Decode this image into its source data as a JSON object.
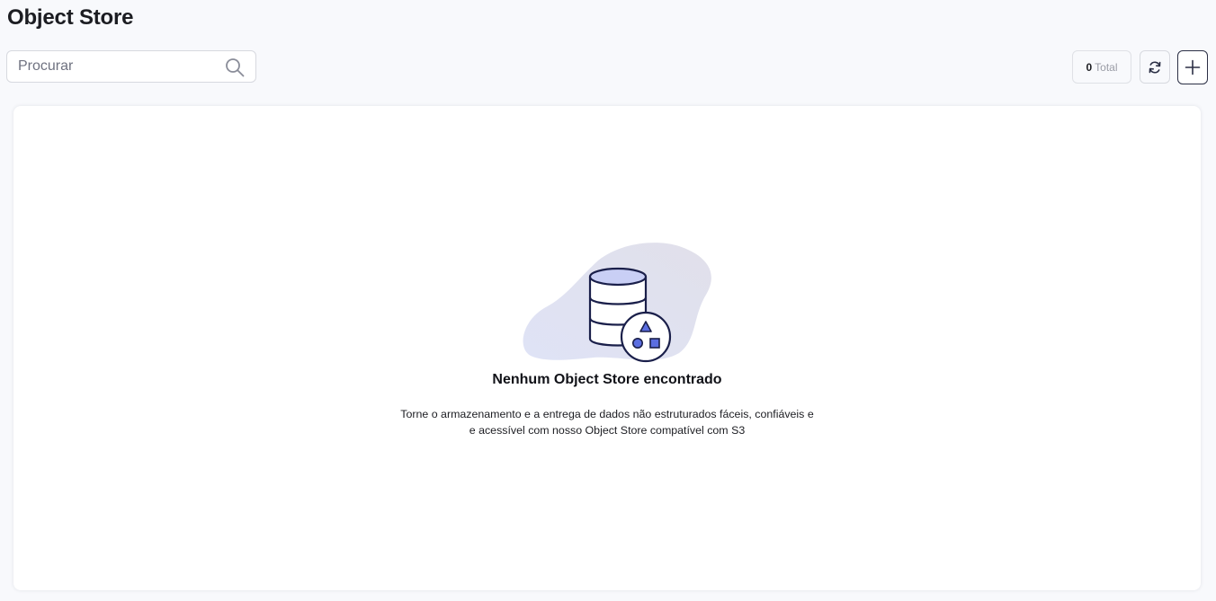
{
  "header": {
    "title": "Object Store"
  },
  "toolbar": {
    "search_placeholder": "Procurar",
    "search_value": "",
    "total_count": "0",
    "total_label": "Total",
    "search_icon": "search-icon",
    "refresh_icon": "refresh-icon",
    "add_icon": "plus-icon"
  },
  "empty_state": {
    "title": "Nenhum Object Store encontrado",
    "description_line1": "Torne o armazenamento e a entrega de dados não estruturados fáceis, confiáveis e",
    "description_line2": "e acessível com nosso Object Store compatível com S3",
    "illustration_icon": "database-shapes-icon"
  },
  "colors": {
    "background": "#f8f9fc",
    "card": "#ffffff",
    "text_primary": "#1c1d22",
    "text_muted": "#9a9ca6",
    "accent": "#5b6ee1",
    "accent_light": "#c9cff5",
    "blob": "#e3e4ee",
    "outline": "#1a1f4a"
  }
}
